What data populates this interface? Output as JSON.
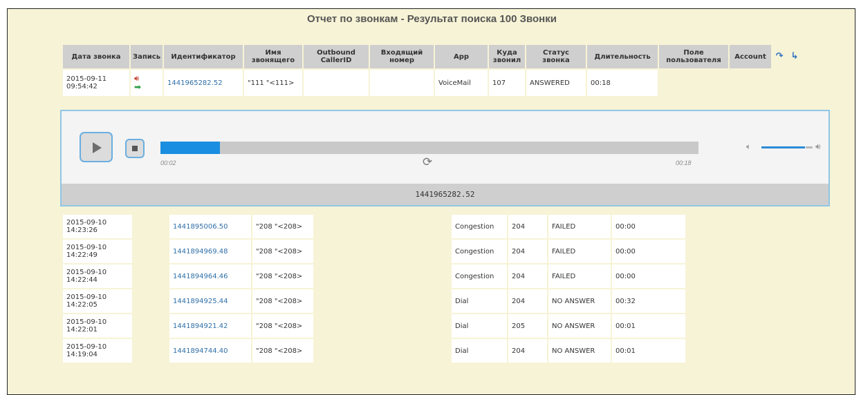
{
  "title": "Отчет по звонкам - Результат поиска 100 Звонки",
  "columns": [
    "Дата звонка",
    "Запись",
    "Идентификатор",
    "Имя звонящего",
    "Outbound CallerID",
    "Входящий номер",
    "App",
    "Куда звонил",
    "Статус звонка",
    "Длительность",
    "Поле пользователя",
    "Account"
  ],
  "icons": {
    "nav_prev": "arrow-back-icon",
    "nav_next": "arrow-forward-icon",
    "play_audio": "speaker-icon",
    "download": "download-icon"
  },
  "first_row": {
    "date": "2015-09-11 09:54:42",
    "id": "1441965282.52",
    "caller": "\"111 \"<111>",
    "app": "VoiceMail",
    "dst": "107",
    "status": "ANSWERED",
    "duration": "00:18"
  },
  "player": {
    "current": "00:02",
    "total": "00:18",
    "progress": 0.11,
    "volume": 0.85,
    "label": "1441965282.52"
  },
  "rows": [
    {
      "date": "2015-09-10 14:23:26",
      "id": "1441895006.50",
      "caller": "\"208 \"<208>",
      "app": "Congestion",
      "dst": "204",
      "status": "FAILED",
      "duration": "00:00"
    },
    {
      "date": "2015-09-10 14:22:49",
      "id": "1441894969.48",
      "caller": "\"208 \"<208>",
      "app": "Congestion",
      "dst": "204",
      "status": "FAILED",
      "duration": "00:00"
    },
    {
      "date": "2015-09-10 14:22:44",
      "id": "1441894964.46",
      "caller": "\"208 \"<208>",
      "app": "Congestion",
      "dst": "204",
      "status": "FAILED",
      "duration": "00:00"
    },
    {
      "date": "2015-09-10 14:22:05",
      "id": "1441894925.44",
      "caller": "\"208 \"<208>",
      "app": "Dial",
      "dst": "204",
      "status": "NO ANSWER",
      "duration": "00:32"
    },
    {
      "date": "2015-09-10 14:22:01",
      "id": "1441894921.42",
      "caller": "\"208 \"<208>",
      "app": "Dial",
      "dst": "205",
      "status": "NO ANSWER",
      "duration": "00:01"
    },
    {
      "date": "2015-09-10 14:19:04",
      "id": "1441894744.40",
      "caller": "\"208 \"<208>",
      "app": "Dial",
      "dst": "204",
      "status": "NO ANSWER",
      "duration": "00:01"
    }
  ]
}
